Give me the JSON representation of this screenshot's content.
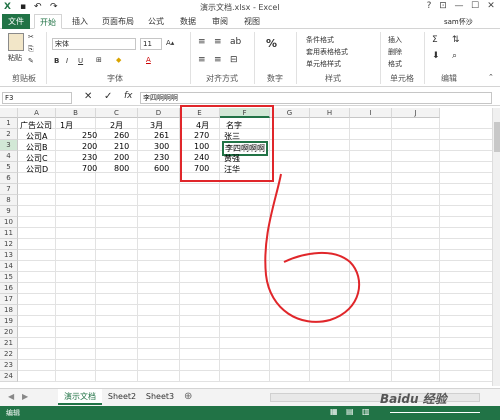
{
  "title": "演示文档.xlsx - Excel",
  "window_buttons": [
    "?",
    "⊡",
    "—",
    "☐",
    "✕"
  ],
  "user": "sam怀沙",
  "tabs": [
    "文件",
    "开始",
    "插入",
    "页面布局",
    "公式",
    "数据",
    "审阅",
    "视图"
  ],
  "ribbon": {
    "paste": "粘贴",
    "clipboard": "剪贴板",
    "font_name": "宋体",
    "font_size": "11",
    "font_group": "字体",
    "align_group": "对齐方式",
    "number_group": "数字",
    "styles": [
      "条件格式",
      "套用表格格式",
      "单元格样式"
    ],
    "styles_group": "样式",
    "cells": [
      "插入",
      "删除",
      "格式"
    ],
    "cells_group": "单元格",
    "edit_group": "编辑",
    "percent": "%",
    "bold": "B",
    "italic": "I",
    "underline": "U",
    "font_color": "A"
  },
  "formula_bar": {
    "name_box": "F3",
    "content": "李四啊啊啊",
    "fx": "fx"
  },
  "columns": [
    "A",
    "B",
    "C",
    "D",
    "E",
    "F",
    "G",
    "H",
    "I",
    "J"
  ],
  "rows": [
    "1",
    "2",
    "3",
    "4",
    "5",
    "6",
    "7",
    "8",
    "9",
    "10",
    "11",
    "12",
    "13",
    "14",
    "15",
    "16",
    "17",
    "18",
    "19",
    "20",
    "21",
    "22",
    "23",
    "24"
  ],
  "cells": {
    "a1": "广告公司",
    "b1": "1月",
    "c1": "2月",
    "d1": "3月",
    "e1": "4月",
    "f1": "名字",
    "a2": "公司A",
    "b2": "250",
    "c2": "260",
    "d2": "261",
    "e2": "270",
    "f2": "张三",
    "a3": "公司B",
    "b3": "200",
    "c3": "210",
    "d3": "300",
    "e3": "100",
    "f3": "李四啊啊啊",
    "a4": "公司C",
    "b4": "230",
    "c4": "200",
    "d4": "230",
    "e4": "240",
    "f4": "黄强",
    "a5": "公司D",
    "b5": "700",
    "c5": "800",
    "d5": "600",
    "e5": "700",
    "f5": "汪华"
  },
  "sheets": [
    "演示文档",
    "Sheet2",
    "Sheet3"
  ],
  "add_sheet": "⊕",
  "status": "编辑",
  "colors": {
    "accent": "#217346",
    "annotation": "#e0262a"
  },
  "watermark": "Baidu 经验"
}
